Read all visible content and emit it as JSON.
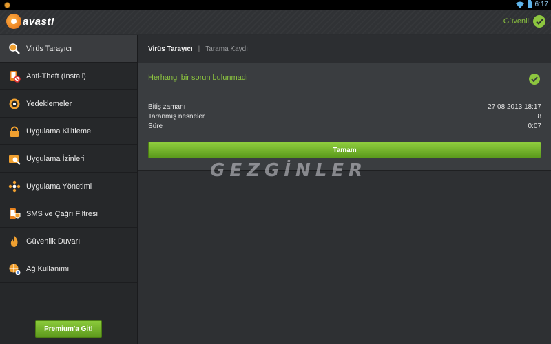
{
  "status_bar": {
    "time": "6:17"
  },
  "header": {
    "logo_text": "avast!",
    "status_label": "Güvenli"
  },
  "sidebar": {
    "items": [
      {
        "label": "Virüs Tarayıcı",
        "icon": "virus-scanner-icon"
      },
      {
        "label": "Anti-Theft (Install)",
        "icon": "anti-theft-icon"
      },
      {
        "label": "Yedeklemeler",
        "icon": "backup-icon"
      },
      {
        "label": "Uygulama Kilitleme",
        "icon": "lock-icon"
      },
      {
        "label": "Uygulama İzinleri",
        "icon": "permissions-icon"
      },
      {
        "label": "Uygulama Yönetimi",
        "icon": "app-manager-icon"
      },
      {
        "label": "SMS ve Çağrı Filtresi",
        "icon": "sms-filter-icon"
      },
      {
        "label": "Güvenlik Duvarı",
        "icon": "firewall-icon"
      },
      {
        "label": "Ağ Kullanımı",
        "icon": "network-usage-icon"
      }
    ],
    "premium_button": "Premium'a Git!"
  },
  "main": {
    "tabs": [
      {
        "label": "Virüs Tarayıcı"
      },
      {
        "label": "Tarama Kaydı"
      }
    ],
    "tab_separator": "|",
    "result_text": "Herhangi bir sorun bulunmadı",
    "details": [
      {
        "label": "Bitiş zamanı",
        "value": "27 08 2013 18:17"
      },
      {
        "label": "Taranmış nesneler",
        "value": "8"
      },
      {
        "label": "Süre",
        "value": "0:07"
      }
    ],
    "ok_button": "Tamam"
  },
  "watermark": "GEZGİNLER",
  "colors": {
    "accent_green": "#8dc63f",
    "brand_orange": "#e8831f"
  }
}
